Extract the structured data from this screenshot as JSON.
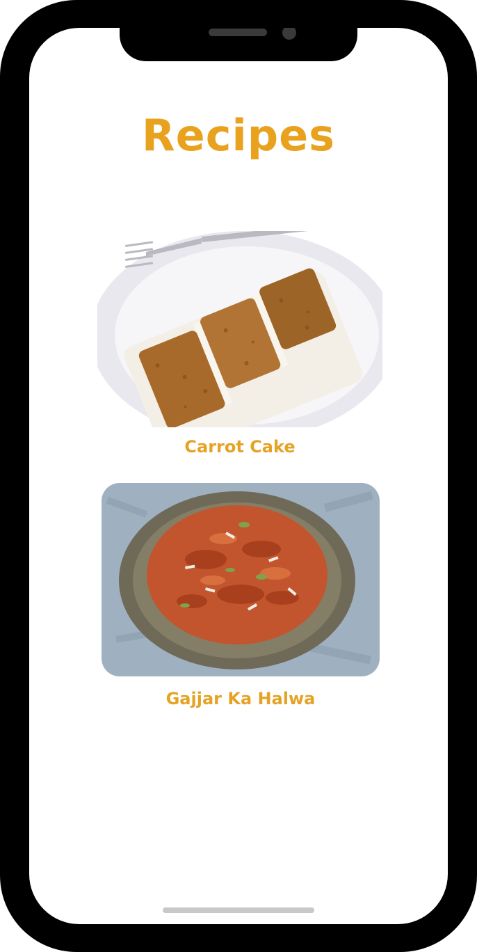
{
  "app": {
    "title": "Recipes"
  },
  "recipes": [
    {
      "name": "Carrot Cake",
      "image_subject": "carrot-cake-slice"
    },
    {
      "name": "Gajjar Ka Halwa",
      "image_subject": "gajjar-ka-halwa-bowl"
    }
  ],
  "colors": {
    "accent": "#e8a21e",
    "frame": "#000000",
    "screen": "#ffffff"
  }
}
